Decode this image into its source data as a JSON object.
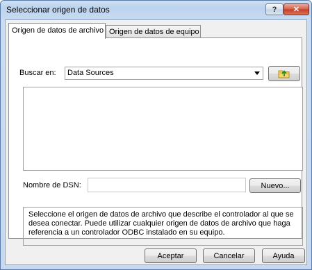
{
  "window": {
    "title": "Seleccionar origen de datos",
    "help_glyph": "?",
    "close_glyph": "✕"
  },
  "tabs": [
    {
      "label": "Origen de datos de archivo",
      "active": true
    },
    {
      "label": "Origen de datos de equipo",
      "active": false
    }
  ],
  "lookin": {
    "label": "Buscar en:",
    "value": "Data Sources"
  },
  "dsn": {
    "label": "Nombre de DSN:",
    "value": "",
    "new_button": "Nuevo..."
  },
  "description": "Seleccione el origen de datos de archivo que describe el controlador al que se desea conectar. Puede utilizar cualquier origen de datos de archivo que haga referencia a un controlador ODBC instalado en su equipo.",
  "buttons": {
    "ok": "Aceptar",
    "cancel": "Cancelar",
    "help": "Ayuda"
  },
  "icons": {
    "up_folder": "folder-up-icon"
  },
  "colors": {
    "title_bar": "#c6d9f0",
    "close_button": "#c43b24",
    "dialog_bg": "#f0f0f0"
  }
}
